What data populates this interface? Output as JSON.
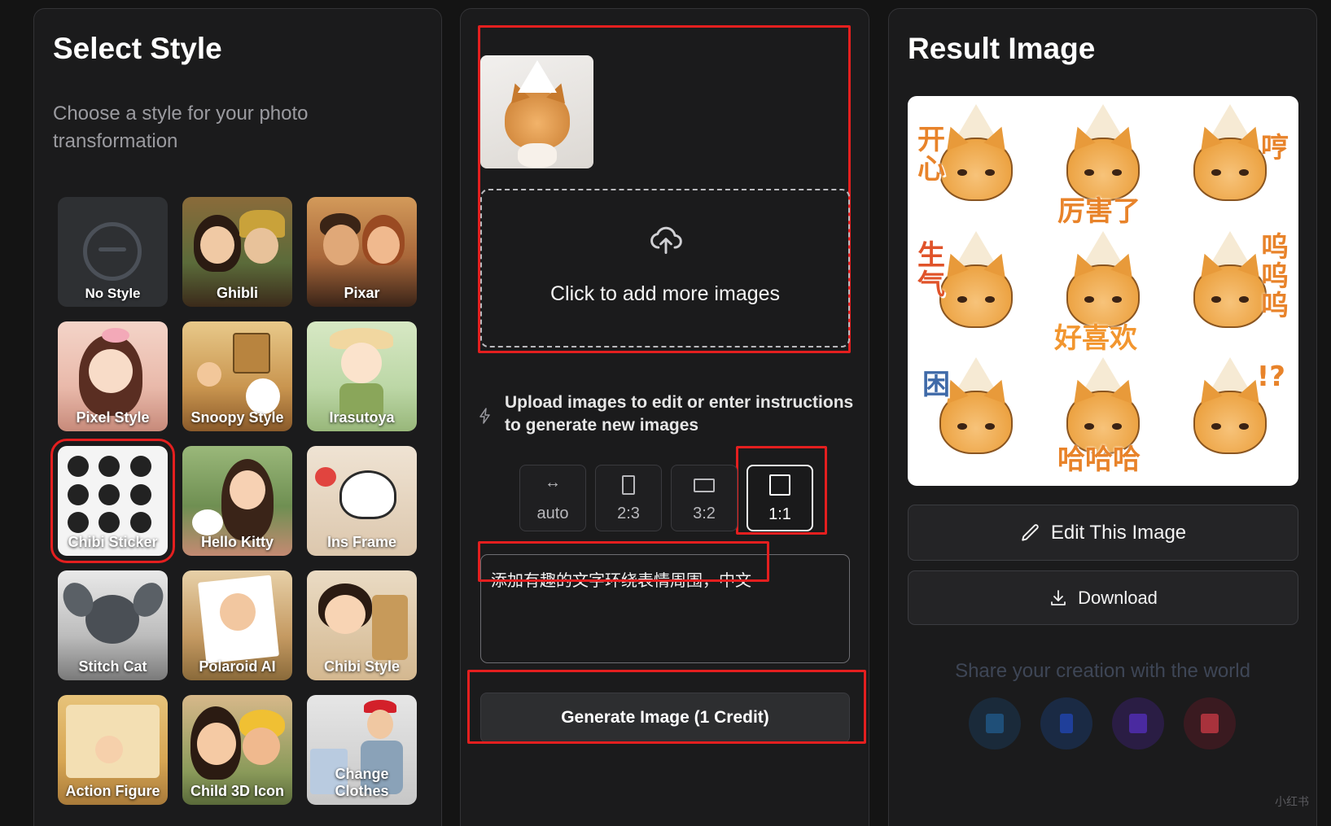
{
  "left_panel": {
    "title": "Select Style",
    "subtitle": "Choose a style for your photo transformation",
    "styles": [
      {
        "label": "No Style"
      },
      {
        "label": "Ghibli"
      },
      {
        "label": "Pixar"
      },
      {
        "label": "Pixel Style"
      },
      {
        "label": "Snoopy Style"
      },
      {
        "label": "Irasutoya"
      },
      {
        "label": "Chibi Sticker",
        "selected": true
      },
      {
        "label": "Hello Kitty"
      },
      {
        "label": "Ins Frame"
      },
      {
        "label": "Stitch Cat"
      },
      {
        "label": "Polaroid AI"
      },
      {
        "label": "Chibi Style"
      },
      {
        "label": "Action Figure"
      },
      {
        "label": "Child 3D Icon"
      },
      {
        "label": "Change Clothes"
      }
    ]
  },
  "middle_panel": {
    "dropzone_label": "Click to add more images",
    "hint": "Upload images to edit or enter instructions to generate new images",
    "ratios": [
      {
        "label": "auto",
        "icon": "auto-arrows-icon"
      },
      {
        "label": "2:3",
        "icon": "portrait-icon"
      },
      {
        "label": "3:2",
        "icon": "landscape-icon"
      },
      {
        "label": "1:1",
        "icon": "square-icon",
        "active": true
      }
    ],
    "prompt_value": "添加有趣的文字环绕表情周围，中文",
    "generate_label": "Generate Image (1 Credit)"
  },
  "right_panel": {
    "title": "Result Image",
    "sticker_texts": [
      "开心",
      "厉害了",
      "哼",
      "生气",
      "好喜欢",
      "呜呜呜",
      "困",
      "哈哈哈",
      "!?"
    ],
    "edit_label": "Edit This Image",
    "download_label": "Download",
    "share_title": "Share your creation with the world",
    "share_buttons": [
      {
        "icon": "share-icon-1",
        "color": "#1a2a3a"
      },
      {
        "icon": "share-icon-2",
        "color": "#1a2a44"
      },
      {
        "icon": "share-icon-3",
        "color": "#2a1d44"
      },
      {
        "icon": "share-icon-4",
        "color": "#3a1a20"
      }
    ]
  },
  "watermark": "小红书",
  "colors": {
    "accent_red": "#e41f1f",
    "panel_bg": "#1b1b1c",
    "page_bg": "#141414"
  }
}
